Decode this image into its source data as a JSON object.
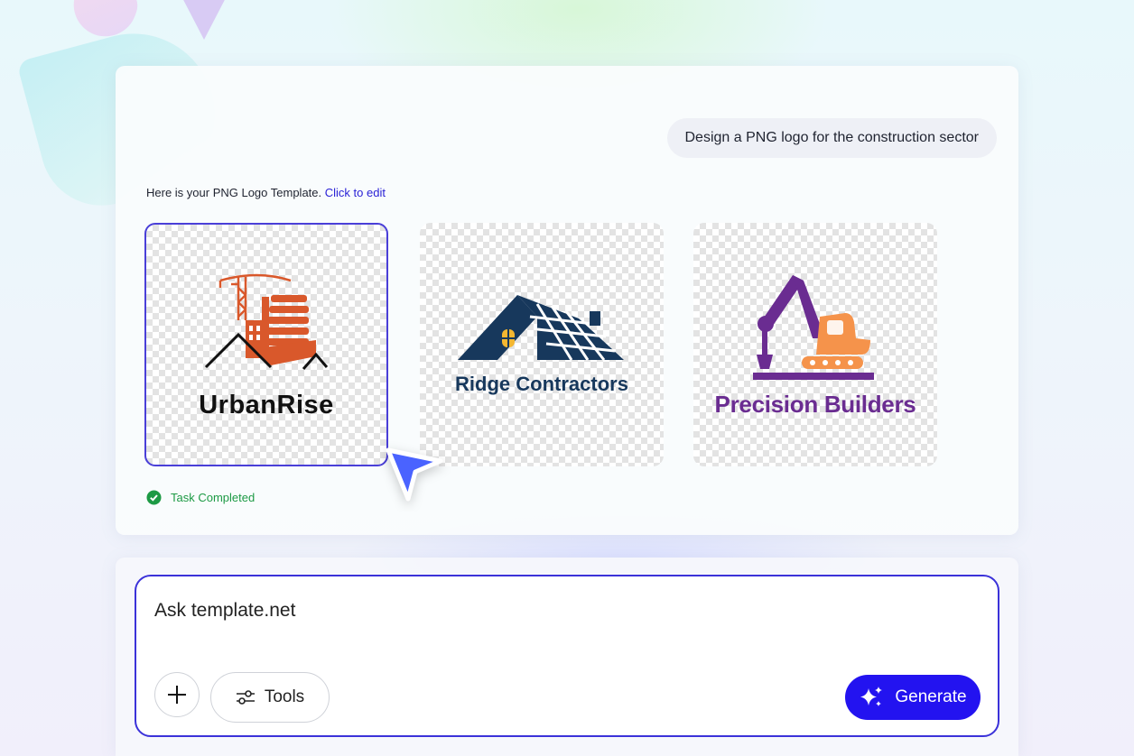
{
  "chat": {
    "user_message": "Design a PNG logo for the construction sector",
    "response_intro": "Here is your PNG Logo Template. ",
    "response_link": "Click to edit",
    "status": "Task Completed"
  },
  "templates": [
    {
      "name": "UrbanRise",
      "selected": true,
      "colors": {
        "primary": "#d9582b",
        "text": "#111111"
      }
    },
    {
      "name": "Ridge Contractors",
      "selected": false,
      "colors": {
        "primary": "#17385c",
        "window": "#f4b731"
      }
    },
    {
      "name": "Precision Builders",
      "selected": false,
      "colors": {
        "primary": "#6a2c91",
        "accent": "#f5934b"
      }
    }
  ],
  "composer": {
    "placeholder": "Ask template.net",
    "add_icon": "plus-icon",
    "tools_label": "Tools",
    "tools_icon": "sliders-icon",
    "generate_label": "Generate",
    "generate_icon": "sparkle-icon"
  },
  "colors": {
    "accent": "#2313f0",
    "selected_border": "#4a3fd8",
    "link": "#2b22d6",
    "success": "#1d9a45"
  }
}
